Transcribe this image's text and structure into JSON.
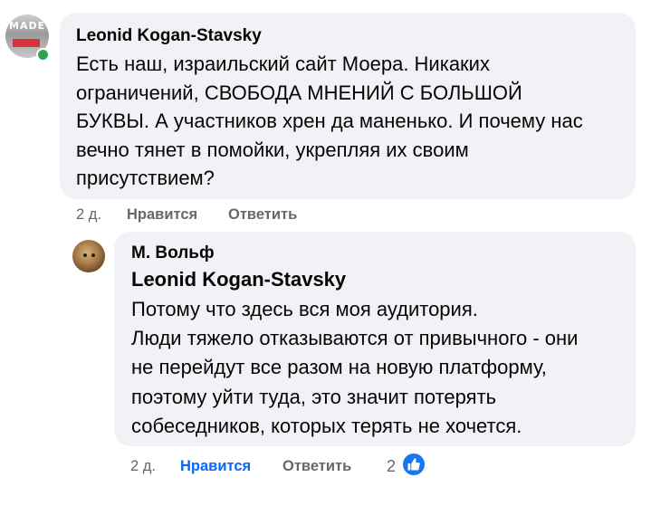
{
  "comment": {
    "avatar_text": "MADE",
    "author": "Leonid Kogan-Stavsky",
    "text": "Есть наш, израильский сайт Моера. Никаких\nограничений, СВОБОДА МНЕНИЙ С БОЛЬШОЙ\nБУКВЫ. А участников хрен да маненько. И почему нас\nвечно тянет в помойки, укрепляя их своим\nприсутствием?",
    "time": "2 д.",
    "like_label": "Нравится",
    "reply_label": "Ответить",
    "online": true
  },
  "reply": {
    "author": "М. Вольф",
    "mention": "Leonid Kogan-Stavsky",
    "text": "Потому что здесь вся моя аудитория.\nЛюди тяжело отказываются от привычного - они\nне перейдут все разом на новую платформу,\nпоэтому уйти туда, это значит потерять\nсобеседников, которых терять не хочется.",
    "time": "2 д.",
    "like_label": "Нравится",
    "reply_label": "Ответить",
    "liked": true,
    "reaction_count": "2",
    "reaction_icon": "thumbs-up-icon"
  },
  "colors": {
    "bubble": "#f0f2f5",
    "meta": "#65676b",
    "liked": "#0866ff",
    "online": "#31a24c",
    "reaction_badge": "#1877f2"
  }
}
